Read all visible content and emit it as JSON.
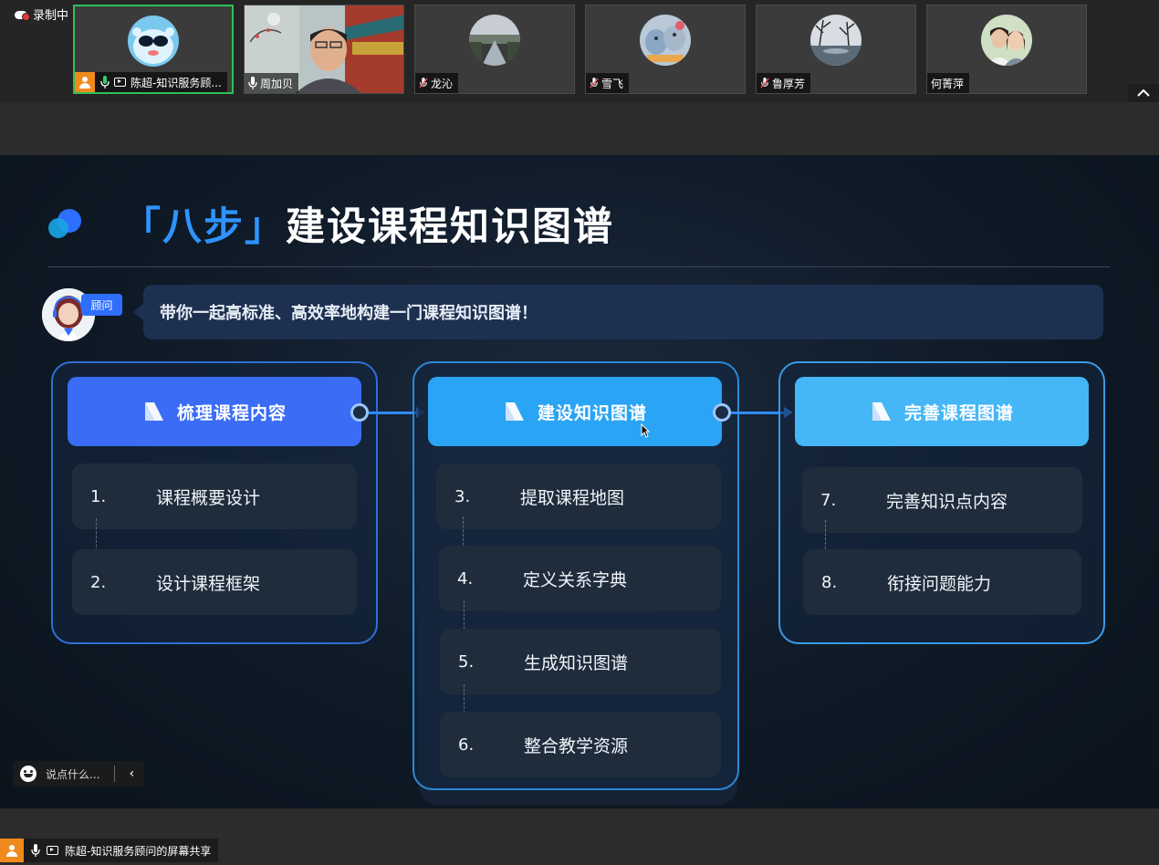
{
  "recording": {
    "label": "录制中"
  },
  "participants": [
    {
      "name": "陈超-知识服务顾...",
      "active": true,
      "host": true,
      "sharing": true,
      "mic": "on"
    },
    {
      "name": "周加贝",
      "active": false,
      "host": false,
      "sharing": false,
      "mic": "on"
    },
    {
      "name": "龙沁",
      "active": false,
      "host": false,
      "sharing": false,
      "mic": "muted"
    },
    {
      "name": "雪飞",
      "active": false,
      "host": false,
      "sharing": false,
      "mic": "muted"
    },
    {
      "name": "鲁厚芳",
      "active": false,
      "host": false,
      "sharing": false,
      "mic": "muted"
    },
    {
      "name": "何菁萍",
      "active": false,
      "host": false,
      "sharing": false,
      "mic": "none"
    }
  ],
  "slide": {
    "title_open": "「八步」",
    "title_rest": "建设课程知识图谱",
    "advisor_tag": "顾问",
    "bubble_text": "带你一起高标准、高效率地构建一门课程知识图谱！",
    "groups": [
      {
        "title": "梳理课程内容",
        "steps": [
          {
            "num": "1.",
            "text": "课程概要设计"
          },
          {
            "num": "2.",
            "text": "设计课程框架"
          }
        ]
      },
      {
        "title": "建设知识图谱",
        "steps": [
          {
            "num": "3.",
            "text": "提取课程地图"
          },
          {
            "num": "4.",
            "text": "定义关系字典"
          },
          {
            "num": "5.",
            "text": "生成知识图谱"
          },
          {
            "num": "6.",
            "text": "整合教学资源"
          }
        ]
      },
      {
        "title": "完善课程图谱",
        "steps": [
          {
            "num": "7.",
            "text": "完善知识点内容"
          },
          {
            "num": "8.",
            "text": "衔接问题能力"
          }
        ]
      }
    ]
  },
  "chat": {
    "placeholder": "说点什么..."
  },
  "share": {
    "label": "陈超-知识服务顾问的屏幕共享"
  },
  "colors": {
    "accent": "#2f93ff",
    "head1": "#3a6cf5",
    "head2": "#2aa4f4",
    "head3": "#45b6f6",
    "active_border": "#2fbf56",
    "host": "#f08a1c"
  }
}
